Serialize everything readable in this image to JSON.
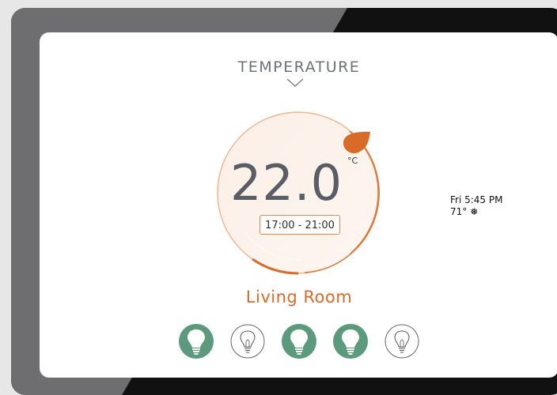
{
  "header": {
    "title": "TEMPERATURE"
  },
  "thermostat": {
    "temperature": "22.0",
    "unit": "°C",
    "schedule": "17:00 - 21:00",
    "room": "Living Room"
  },
  "status": {
    "datetime": "Fri 5:45 PM",
    "outdoor_temp": "71°",
    "weather_icon": "snowflake-icon"
  },
  "lights": [
    {
      "name": "light-1",
      "state": "on"
    },
    {
      "name": "light-2",
      "state": "off"
    },
    {
      "name": "light-3",
      "state": "on"
    },
    {
      "name": "light-4",
      "state": "on"
    },
    {
      "name": "light-5",
      "state": "off"
    }
  ],
  "colors": {
    "accent": "#d96b29",
    "light_on": "#5c9a7e",
    "text": "#585d66"
  }
}
